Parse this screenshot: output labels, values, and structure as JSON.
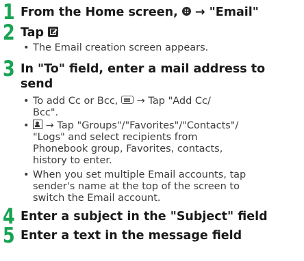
{
  "steps": [
    {
      "number": "1",
      "title_before": "From the Home screen,",
      "title_after": "→ \"Email\"",
      "icon": "home-icon"
    },
    {
      "number": "2",
      "title": "Tap",
      "icon": "compose-icon",
      "bullets": [
        "The Email creation screen appears."
      ]
    },
    {
      "number": "3",
      "title_line1": "In \"To\" field, enter a mail address to",
      "title_line2": "send",
      "bullets": [
        {
          "icon": "menu-icon",
          "before": "To add Cc or Bcc,",
          "after": "→ Tap \"Add Cc/",
          "cont": [
            "Bcc\"."
          ]
        },
        {
          "icon": "contacts-icon",
          "after": "→ Tap \"Groups\"/\"Favorites\"/\"Contacts\"/",
          "cont": [
            "\"Logs\" and select recipients from",
            "Phonebook group, Favorites, contacts,",
            "history to enter."
          ]
        },
        {
          "lines": [
            "When you set multiple Email accounts, tap",
            "sender's name at the top of the screen to",
            "switch the Email account."
          ]
        }
      ]
    },
    {
      "number": "4",
      "title": "Enter a subject in the \"Subject\" field"
    },
    {
      "number": "5",
      "title": "Enter a text in the message field"
    }
  ],
  "bullet_char": "•",
  "colors": {
    "step_number": "#18a352",
    "text": "#1a1a1a",
    "bullet_text": "#3c3c3c"
  }
}
